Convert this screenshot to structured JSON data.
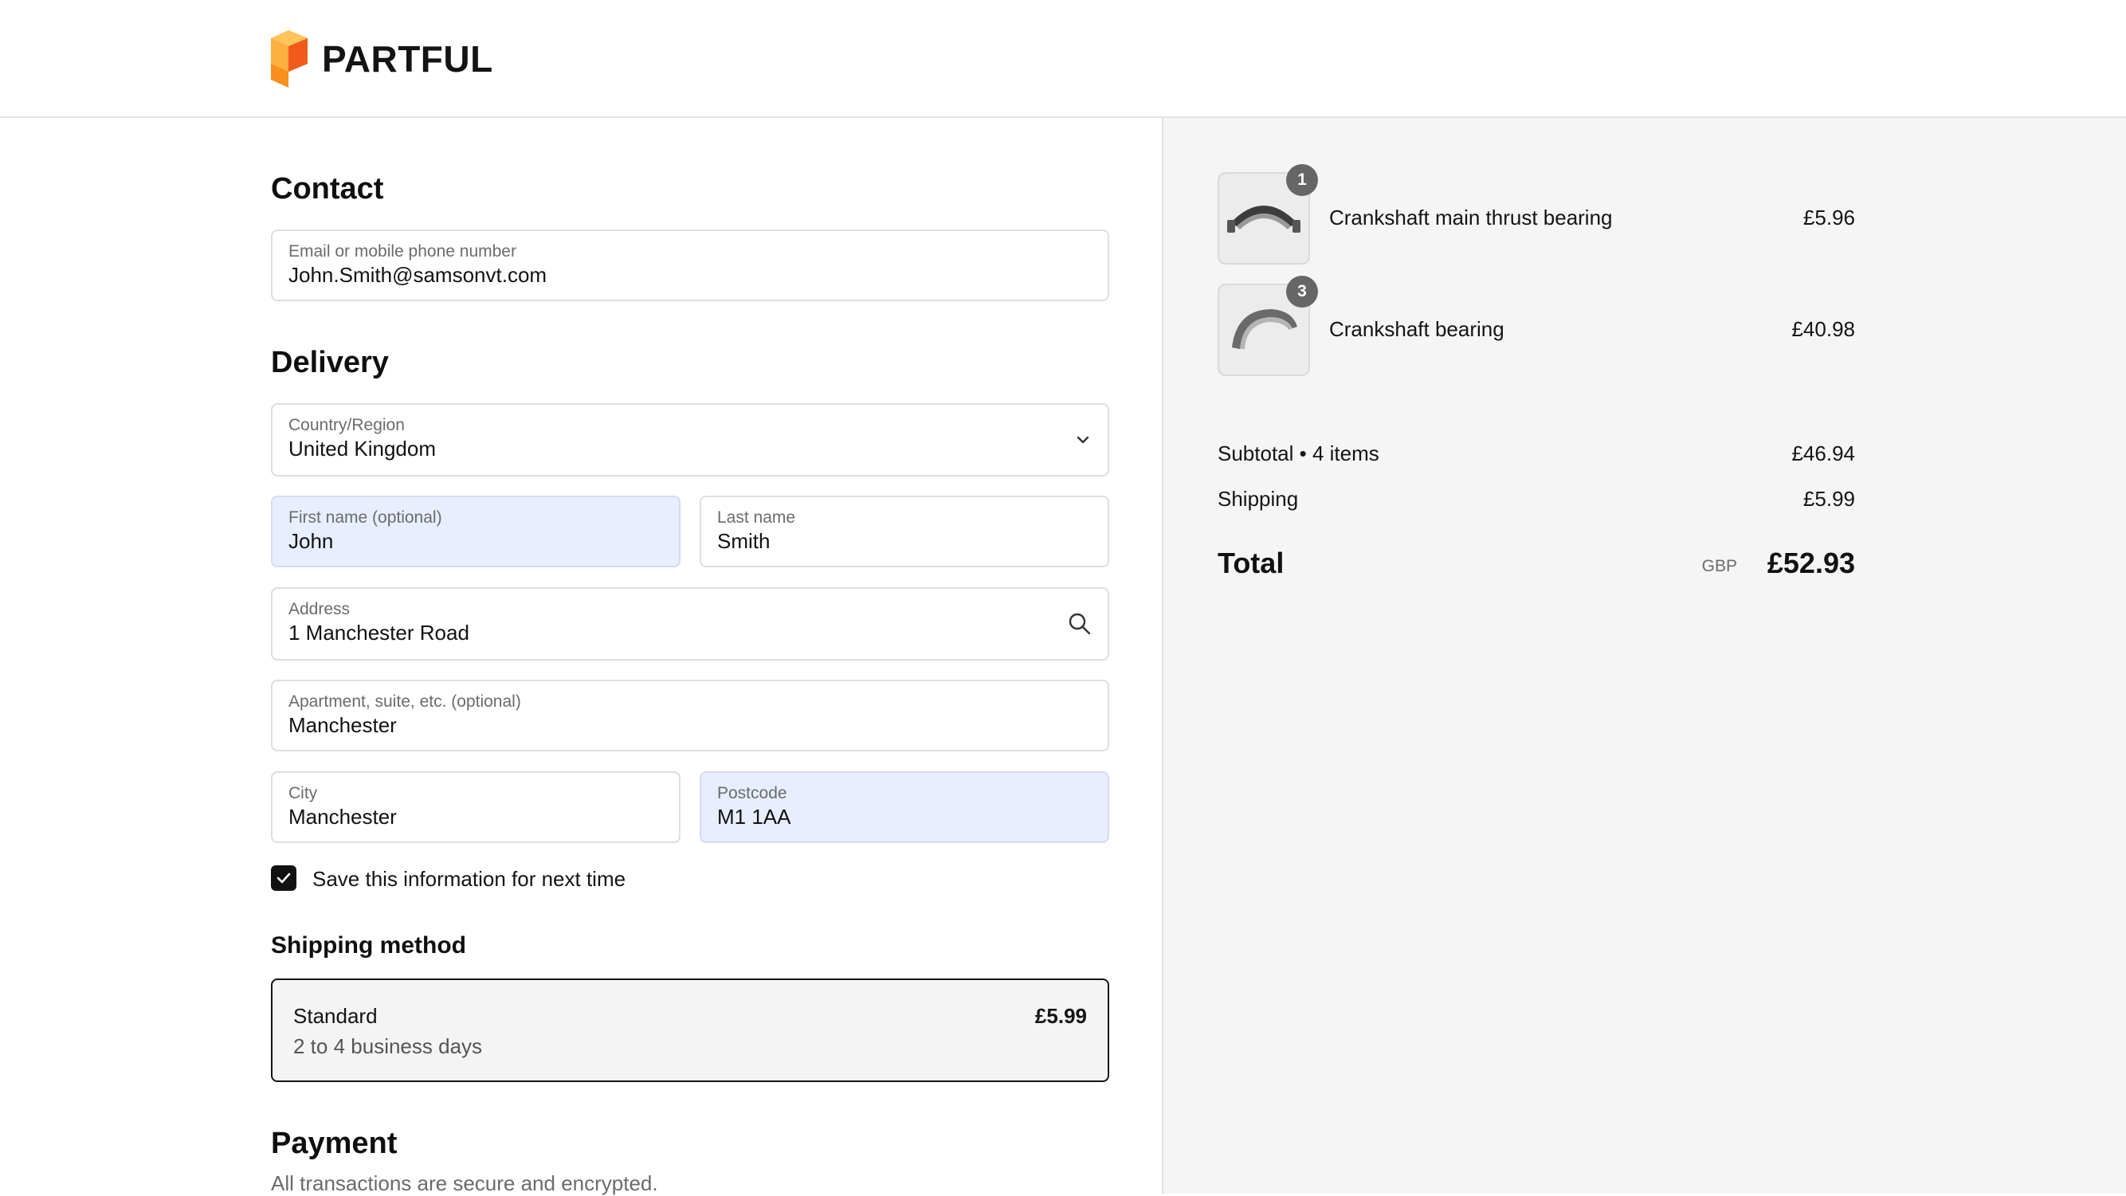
{
  "brand": {
    "name": "PARTFUL",
    "logo_icon": "partful-logo-icon",
    "logo_color": "#f7901e"
  },
  "contact": {
    "heading": "Contact",
    "email": {
      "label": "Email or mobile phone number",
      "value": "John.Smith@samsonvt.com"
    }
  },
  "delivery": {
    "heading": "Delivery",
    "country": {
      "label": "Country/Region",
      "value": "United Kingdom"
    },
    "first_name": {
      "label": "First name (optional)",
      "value": "John"
    },
    "last_name": {
      "label": "Last name",
      "value": "Smith"
    },
    "address": {
      "label": "Address",
      "value": "1 Manchester Road"
    },
    "apartment": {
      "label": "Apartment, suite, etc. (optional)",
      "value": "Manchester"
    },
    "city": {
      "label": "City",
      "value": "Manchester"
    },
    "postcode": {
      "label": "Postcode",
      "value": "M1 1AA"
    },
    "save_info": {
      "label": "Save this information for next time",
      "checked": true
    }
  },
  "shipping_method": {
    "heading": "Shipping method",
    "option": {
      "name": "Standard",
      "eta": "2 to 4 business days",
      "price": "£5.99"
    }
  },
  "payment": {
    "heading": "Payment",
    "subtitle": "All transactions are secure and encrypted."
  },
  "order": {
    "items": [
      {
        "quantity": "1",
        "name": "Crankshaft main thrust bearing",
        "price": "£5.96"
      },
      {
        "quantity": "3",
        "name": "Crankshaft bearing",
        "price": "£40.98"
      }
    ],
    "subtotal": {
      "label": "Subtotal • 4 items",
      "value": "£46.94"
    },
    "shipping": {
      "label": "Shipping",
      "value": "£5.99"
    },
    "total": {
      "label": "Total",
      "currency": "GBP",
      "value": "£52.93"
    }
  },
  "colors": {
    "autofill_bg": "#e8eefd",
    "panel_bg": "#f5f5f5"
  }
}
